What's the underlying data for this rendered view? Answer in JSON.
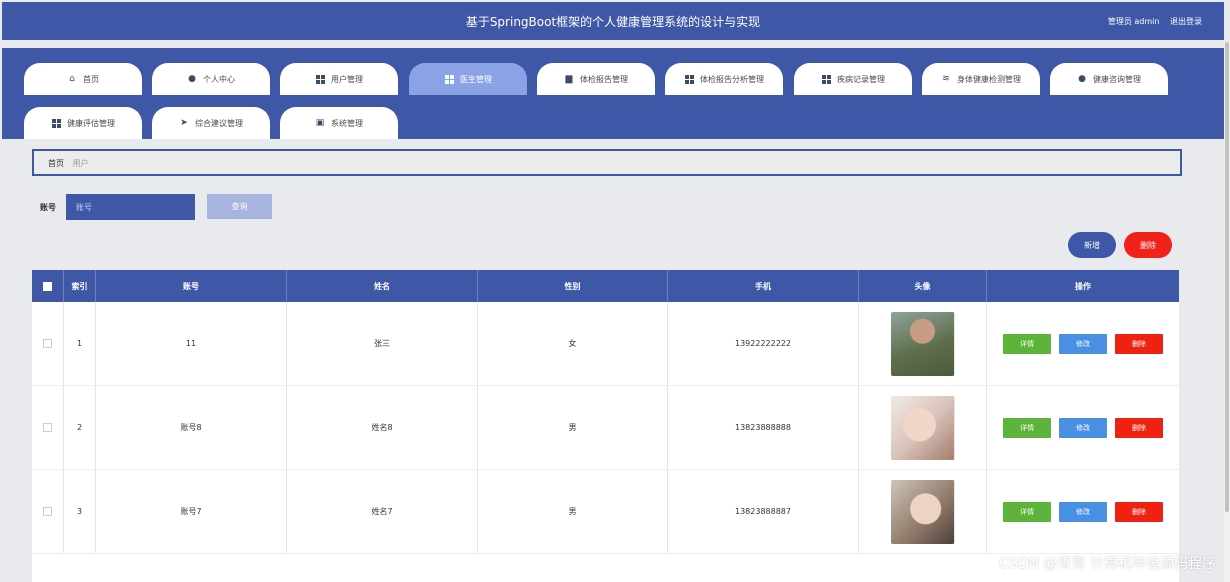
{
  "header": {
    "title": "基于SpringBoot框架的个人健康管理系统的设计与实现",
    "user_role": "管理员 admin",
    "logout": "退出登录"
  },
  "nav": {
    "items": [
      {
        "label": "首页",
        "icon": "home-icon"
      },
      {
        "label": "个人中心",
        "icon": "user-icon"
      },
      {
        "label": "用户管理",
        "icon": "grid-icon"
      },
      {
        "label": "医生管理",
        "icon": "grid-icon"
      },
      {
        "label": "体检报告管理",
        "icon": "briefcase-icon"
      },
      {
        "label": "体检报告分析管理",
        "icon": "grid-icon"
      },
      {
        "label": "疾病记录管理",
        "icon": "grid-icon"
      },
      {
        "label": "身体健康检测管理",
        "icon": "wifi-icon"
      },
      {
        "label": "健康咨询管理",
        "icon": "user-icon"
      },
      {
        "label": "健康评估管理",
        "icon": "grid-icon"
      },
      {
        "label": "综合建议管理",
        "icon": "send-icon"
      },
      {
        "label": "系统管理",
        "icon": "clipboard-icon"
      }
    ],
    "active_index": 3
  },
  "breadcrumb": {
    "home": "首页",
    "current": "用户"
  },
  "search": {
    "label": "账号",
    "placeholder": "账号",
    "button": "查询"
  },
  "actions": {
    "add": "新增",
    "delete": "删除"
  },
  "table": {
    "columns": [
      "索引",
      "账号",
      "姓名",
      "性别",
      "手机",
      "头像",
      "操作"
    ],
    "rows": [
      {
        "index": "1",
        "account": "11",
        "name": "张三",
        "gender": "女",
        "phone": "13922222222",
        "avatar": "avatar-soldier"
      },
      {
        "index": "2",
        "account": "账号8",
        "name": "姓名8",
        "gender": "男",
        "phone": "13823888888",
        "avatar": "avatar-girl-1"
      },
      {
        "index": "3",
        "account": "账号7",
        "name": "姓名7",
        "gender": "男",
        "phone": "13823888887",
        "avatar": "avatar-girl-2"
      }
    ],
    "row_actions": {
      "detail": "详情",
      "edit": "修改",
      "remove": "删除"
    }
  },
  "watermark": "CSDN @青青  计算机毕设源码程序",
  "colors": {
    "primary": "#3e57a6",
    "danger": "#ef2211",
    "success": "#5db33a",
    "info": "#4a90e2",
    "active_tab": "#8ba3e6"
  }
}
